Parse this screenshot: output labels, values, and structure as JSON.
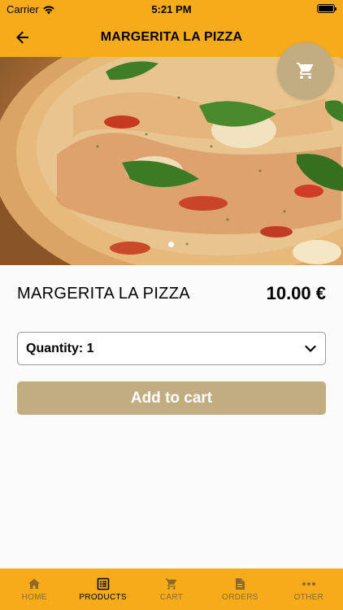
{
  "status_bar": {
    "carrier": "Carrier",
    "time": "5:21 PM"
  },
  "header": {
    "title": "MARGERITA LA PIZZA",
    "back_icon": "arrow-left-icon",
    "background_color": "#f6ab1a"
  },
  "hero": {
    "image": "pizza-margherita-photo",
    "carousel_pages": 1,
    "active_page": 1,
    "cart_button_icon": "shopping-cart-icon"
  },
  "product": {
    "name": "MARGERITA LA PIZZA",
    "price": "10.00 €"
  },
  "quantity_select": {
    "label": "Quantity: 1",
    "selected": "1"
  },
  "add_to_cart": {
    "label": "Add to cart",
    "color": "#c2ad83"
  },
  "tab_bar": {
    "items": [
      {
        "label": "HOME",
        "icon": "home-icon",
        "active": false
      },
      {
        "label": "PRODUCTS",
        "icon": "list-icon",
        "active": true
      },
      {
        "label": "CART",
        "icon": "cart-icon",
        "active": false
      },
      {
        "label": "ORDERS",
        "icon": "document-icon",
        "active": false
      },
      {
        "label": "OTHER",
        "icon": "more-dots-icon",
        "active": false
      }
    ]
  }
}
